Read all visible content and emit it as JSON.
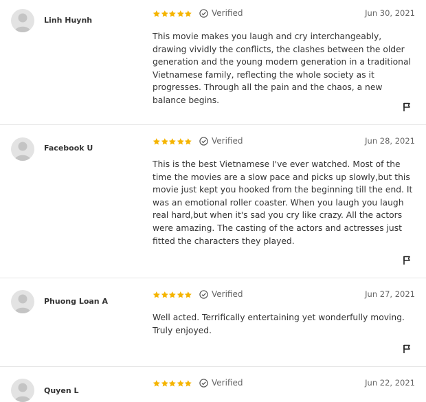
{
  "reviews": [
    {
      "name": "Linh Huynh",
      "rating": 5,
      "verified_label": "Verified",
      "date": "Jun 30, 2021",
      "text": "This movie makes you laugh and cry interchangeably, drawing vividly the conflicts, the clashes between the older generation and the young modern generation in a traditional Vietnamese family, reflecting the whole society as it progresses. Through all the pain and the chaos, a new balance begins."
    },
    {
      "name": "Facebook U",
      "rating": 5,
      "verified_label": "Verified",
      "date": "Jun 28, 2021",
      "text": "This is the best Vietnamese I've ever watched. Most of the time the movies are a slow pace and picks up slowly,but this movie just kept you hooked from the beginning till the end. It was an emotional roller coaster. When you laugh you laugh real hard,but when it's sad you cry like crazy. All the actors were amazing. The casting of the actors and actresses just fitted the characters they played."
    },
    {
      "name": "Phuong Loan A",
      "rating": 5,
      "verified_label": "Verified",
      "date": "Jun 27, 2021",
      "text": "Well acted. Terrifically entertaining yet wonderfully moving. Truly enjoyed."
    },
    {
      "name": "Quyen L",
      "rating": 5,
      "verified_label": "Verified",
      "date": "Jun 22, 2021",
      "text": ""
    }
  ],
  "icons": {
    "star": "star-icon",
    "verified": "check-circle-icon",
    "flag": "flag-icon",
    "avatar": "user-avatar-icon"
  },
  "colors": {
    "star": "#f5b400",
    "divider": "#e6e6e6",
    "avatar_bg": "#e3e3e3",
    "avatar_fg": "#c4c4c4"
  }
}
